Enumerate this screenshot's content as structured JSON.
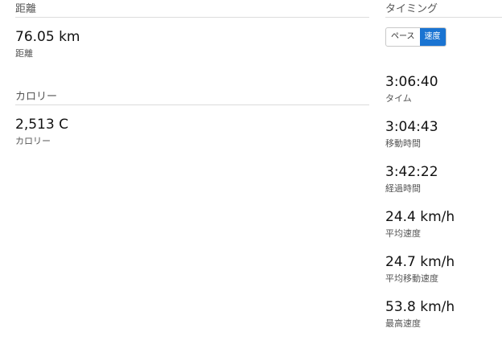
{
  "distance_section": {
    "title": "距離",
    "value": "76.05 km",
    "label": "距離"
  },
  "calorie_section": {
    "title": "カロリー",
    "value": "2,513 C",
    "label": "カロリー"
  },
  "timing_section": {
    "title": "タイミング",
    "toggle": {
      "options": [
        "ペース",
        "速度"
      ],
      "selected": "速度",
      "accent_color": "#1a74d2"
    },
    "stats": [
      {
        "value": "3:06:40",
        "label": "タイム"
      },
      {
        "value": "3:04:43",
        "label": "移動時間"
      },
      {
        "value": "3:42:22",
        "label": "経過時間"
      },
      {
        "value": "24.4 km/h",
        "label": "平均速度"
      },
      {
        "value": "24.7 km/h",
        "label": "平均移動速度"
      },
      {
        "value": "53.8 km/h",
        "label": "最高速度"
      }
    ]
  }
}
